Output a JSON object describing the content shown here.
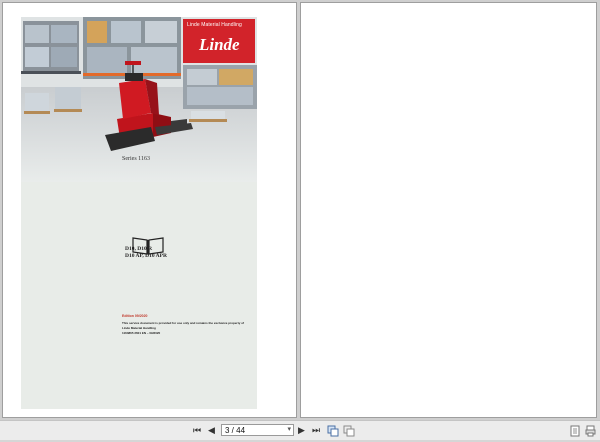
{
  "document": {
    "brand_small": "Linde Material Handling",
    "brand_logo": "Linde",
    "series": "Series 1163",
    "model_line1": "D10, D10 R",
    "model_line2": "D10 AP, D10 APR",
    "edition": "Edition 09/2020",
    "notice": "This service document is provided for use only and remains the exclusive property of",
    "notice_owner": "Linde Material Handling",
    "doc_number": "1163865 2601 EN – 09/2020"
  },
  "toolbar": {
    "first_page": "⏮",
    "prev_page": "◀",
    "page_indicator": "3 / 44",
    "next_page": "▶",
    "last_page": "⏭"
  },
  "colors": {
    "brand_red": "#d2232a",
    "viewer_bg": "#cfcfcf"
  }
}
